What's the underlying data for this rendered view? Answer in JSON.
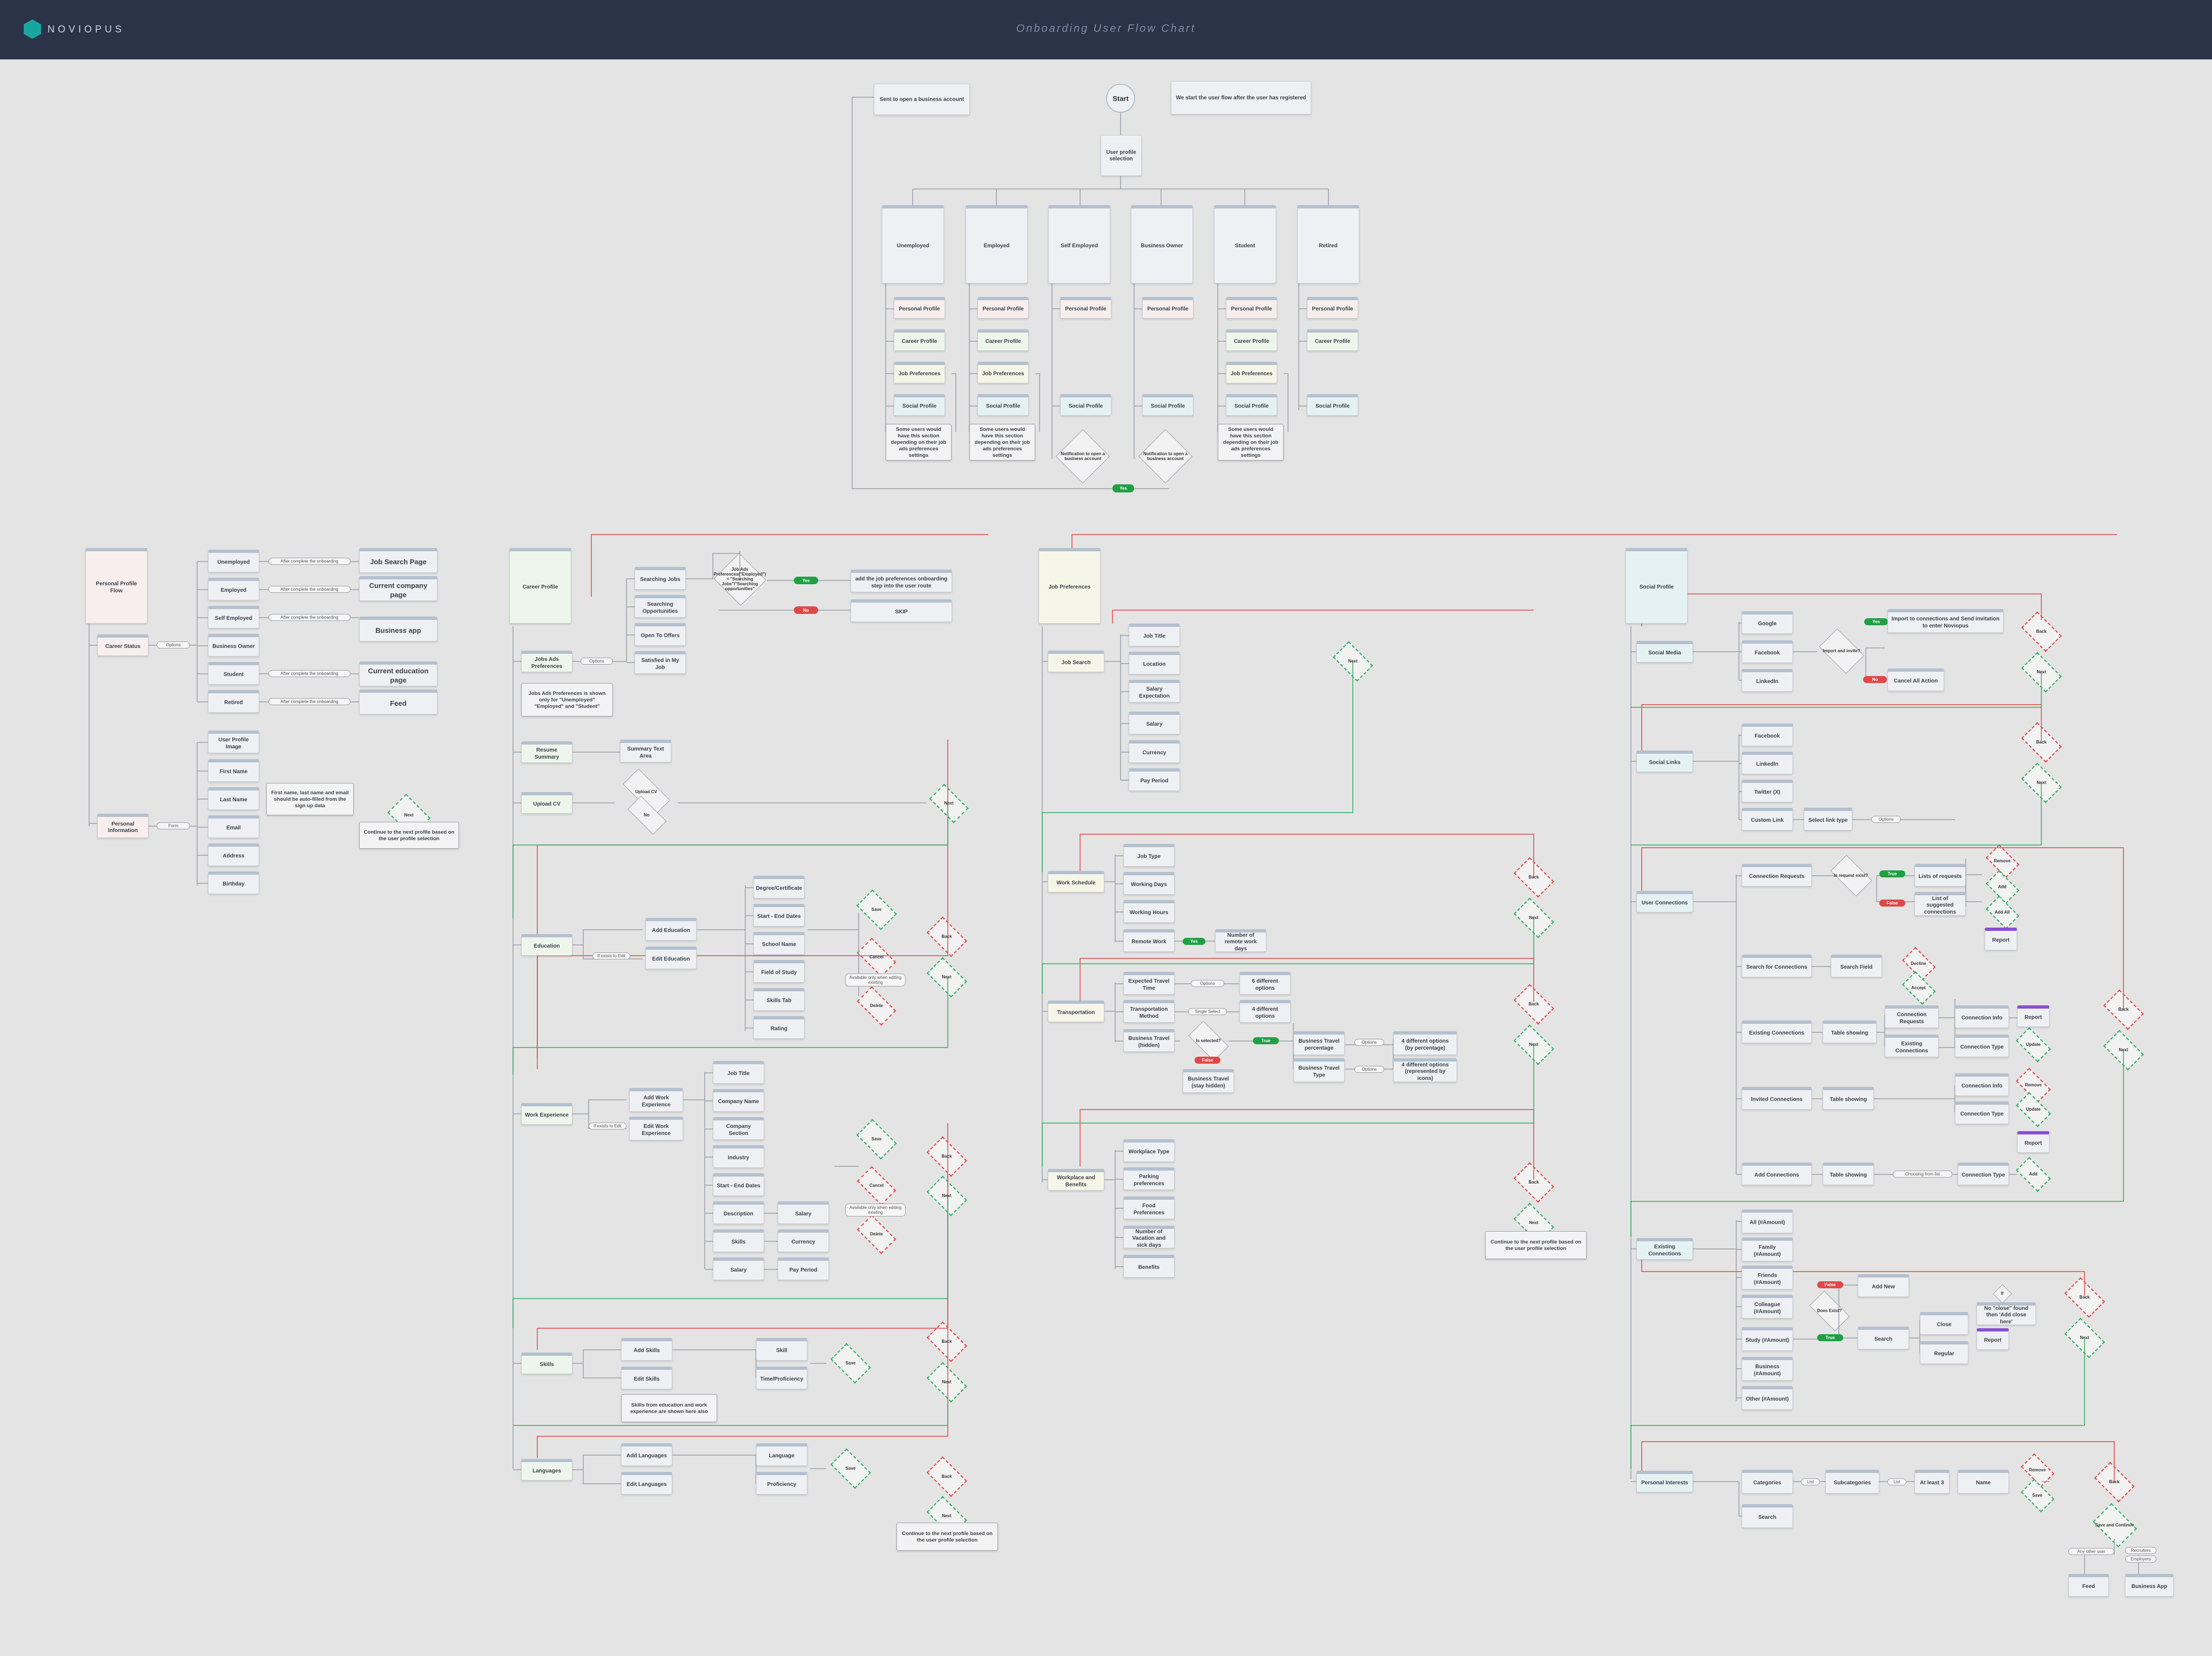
{
  "header": {
    "logo_text": "NOVIOPUS",
    "title": "Onboarding User Flow Chart"
  },
  "texts": {
    "start": "Start",
    "user_profile_selection": "User profile selection",
    "sent_business": "Sent to open a business account",
    "we_start": "We start the user flow after the user has registered",
    "unemployed": "Unemployed",
    "employed": "Employed",
    "self_employed": "Self Employed",
    "business_owner": "Business Owner",
    "student": "Student",
    "retired": "Retired",
    "personal_profile": "Personal Profile",
    "career_profile": "Career Profile",
    "job_preferences": "Job Preferences",
    "social_profile": "Social Profile",
    "some_users_note": "Some users would have this section depending on their job ads preferences settings",
    "notification_business": "Notification to open a business account",
    "yes": "Yes",
    "no": "No",
    "true": "True",
    "false": "False",
    "personal_profile_flow": "Personal Profile Flow",
    "career_status": "Career Status",
    "options": "Options",
    "after_onboarding": "After complete the onboarding",
    "job_search_page": "Job Search Page",
    "current_company_page": "Current company page",
    "business_app": "Business app",
    "current_education_page": "Current education page",
    "feed": "Feed",
    "personal_information": "Personal Information",
    "form": "Form",
    "user_profile_image": "User Profile Image",
    "first_name": "First Name",
    "last_name": "Last Name",
    "email": "Email",
    "address": "Address",
    "birthday": "Birthday",
    "autofilled_note": "First name, last name and email should be auto-filled from the sign up data",
    "next": "Next",
    "back": "Back",
    "save": "Save",
    "cancel": "Cancel",
    "delete": "Delete",
    "continue_next_profile": "Continue to the next profile based on the user profile selection",
    "jobs_ads_preferences": "Jobs Ads Preferences",
    "options_cat": "Options",
    "searching_jobs": "Searching Jobs",
    "searching_opportunities": "Searching Opportunities",
    "open_to_offers": "Open To Offers",
    "satisfied_my_job": "Satisfied in My Job",
    "if_question": "If",
    "job_ads_decision": "Job Ads Preferences(\"Employed\") = \"Searching Jobs\"/\"Searching opportunities\"",
    "add_job_pref_step": "add the job preferences onboarding step into the user route",
    "skip": "SKIP",
    "job_ads_shown_note": "Jobs Ads Preferences is shown only for \"Unemployed\" \"Employed\" and \"Student\"",
    "resume_summary": "Resume Summary",
    "summary_text_area": "Summary Text Area",
    "upload_cv": "Upload CV",
    "upload_cv_q": "Upload CV",
    "education": "Education",
    "if_exists_edit": "If exists to Edit",
    "add_education": "Add Education",
    "edit_education": "Edit Education",
    "degree_certificate": "Degree/Certificate",
    "start_end_dates": "Start - End Dates",
    "school_name": "School Name",
    "field_of_study": "Field of Study",
    "skills_tab": "Skills Tab",
    "rating": "Rating",
    "available_only_editing": "Available only when editing existing",
    "available_only_editing2": "Available only when editing existing",
    "work_experience": "Work Experience",
    "add_work_experience": "Add Work Experience",
    "edit_work_experience": "Edit Work Experience",
    "job_title": "Job Title",
    "company_name": "Company Name",
    "company_section": "Company Section",
    "industry": "Industry",
    "start_end_dates2": "Start - End Dates",
    "description": "Description",
    "skills_item": "Skills",
    "salary": "Salary",
    "currency": "Currency",
    "pay_period": "Pay Period",
    "skills": "Skills",
    "add_skills": "Add Skills",
    "edit_skills": "Edit Skills",
    "skill": "Skill",
    "time_proficiency": "Time/Proficiency",
    "skills_note": "Skills from education and work experience are shown here also",
    "languages": "Languages",
    "add_languages": "Add Languages",
    "edit_languages": "Edit Languages",
    "language": "Language",
    "proficiency": "Proficiency",
    "job_search": "Job Search",
    "location": "Location",
    "salary_expectation": "Salary Expectation",
    "work_schedule": "Work Schedule",
    "job_type": "Job Type",
    "working_days": "Working Days",
    "working_hours": "Working Hours",
    "remote_work": "Remote Work",
    "number_remote_days": "Number of remote work days",
    "transportation": "Transportation",
    "expected_travel_time": "Expected Travel Time",
    "transportation_method": "Transportation Method",
    "business_travel_hidden": "Business Travel (hidden)",
    "single_select": "Single Select",
    "different_options_6": "6 different options",
    "different_options_4": "4 different options",
    "is_selected": "Is selected?",
    "business_travel_stay_hidden": "Business Travel (stay hidden)",
    "business_travel_percentage": "Business Travel percentage",
    "business_travel_type": "Business Travel Type",
    "different_options_pct": "4 different options (by percentage)",
    "different_options_icons": "4 different options (represented by icons)",
    "workplace_benefits": "Workplace and Benefits",
    "workplace_type": "Workplace Type",
    "parking_preferences": "Parking preferences",
    "food_preferences": "Food Preferences",
    "vacation_sick_days": "Number of Vacation and sick days",
    "benefits": "Benefits",
    "social_media": "Social Media",
    "google": "Google",
    "facebook": "Facebook",
    "linkedin": "LinkedIn",
    "import_invite_q": "Import and invite?",
    "import_connections": "Import to connections and Send invitation to enter Noviopus",
    "cancel_all_action": "Cancel All Action",
    "social_links": "Social Links",
    "twitter": "Twitter (X)",
    "custom_link": "Custom Link",
    "select_link_type": "Select link type",
    "user_connections": "User Connections",
    "connection_requests": "Connection Requests",
    "is_request_exist": "Is request exist?",
    "lists_of_requests": "Lists of requests",
    "list_suggested": "List of suggested connections",
    "remove": "Remove",
    "add": "Add",
    "add_all": "Add All",
    "report": "Report",
    "search_for_connections": "Search for Connections",
    "search_field": "Search Field",
    "decline": "Decline",
    "accept": "Accept",
    "existing_connections": "Existing Connections",
    "table_showing": "Table showing",
    "connection_info": "Connection Info",
    "connection_type": "Connection Type",
    "update": "Update",
    "invited_connections": "Invited Connections",
    "add_connections": "Add Connections",
    "choosing_from_list": "Choosing from list",
    "all_amount": "All (#Amount)",
    "family_amount": "Family (#Amount)",
    "friends_amount": "Friends (#Amount)",
    "colleague_amount": "Colleague (#Amount)",
    "study_amount": "Study (#Amount)",
    "business_amount": "Business (#Amount)",
    "other_amount": "Other (#Amount)",
    "add_new": "Add New",
    "does_exist": "Does Exist?",
    "search": "Search",
    "close": "Close",
    "regular": "Regular",
    "no_close_found": "No \"close\" found then 'Add close here'",
    "personal_interests": "Personal Interests",
    "categories": "Categories",
    "list": "List",
    "subcategories": "Subcategories",
    "at_least_3": "At least 3",
    "name": "Name",
    "save_continue": "Save and Continue",
    "any_other_user": "Any other user",
    "recruiters": "Recruiters",
    "employers": "Employers",
    "business_app_end": "Business App",
    "career_profile_flow": "Career Profile",
    "job_preferences_flow": "Job Preferences",
    "social_profile_flow": "Social Profile"
  },
  "colors": {
    "header_bg": "#2b3349",
    "accent": "#1aa6a0",
    "yes": "#1fa043",
    "no": "#e04848"
  }
}
